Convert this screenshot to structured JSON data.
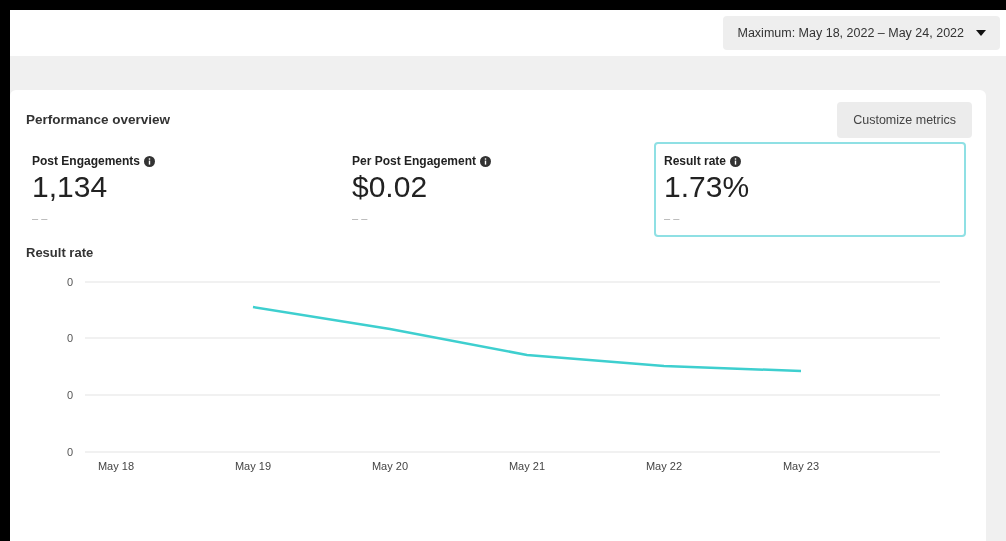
{
  "date_range": {
    "label": "Maximum: May 18, 2022 – May 24, 2022"
  },
  "overview": {
    "title": "Performance overview",
    "customize_button": "Customize metrics",
    "metrics": [
      {
        "label": "Post Engagements",
        "value": "1,134",
        "comparison": "– –",
        "selected": false
      },
      {
        "label": "Per Post Engagement",
        "value": "$0.02",
        "comparison": "– –",
        "selected": false
      },
      {
        "label": "Result rate",
        "value": "1.73%",
        "comparison": "– –",
        "selected": true
      }
    ],
    "chart": {
      "title": "Result rate",
      "y_tick_labels": [
        "0",
        "0",
        "0",
        "0"
      ],
      "x_labels": [
        "May 18",
        "May 19",
        "May 20",
        "May 21",
        "May 22",
        "May 23"
      ]
    }
  }
}
